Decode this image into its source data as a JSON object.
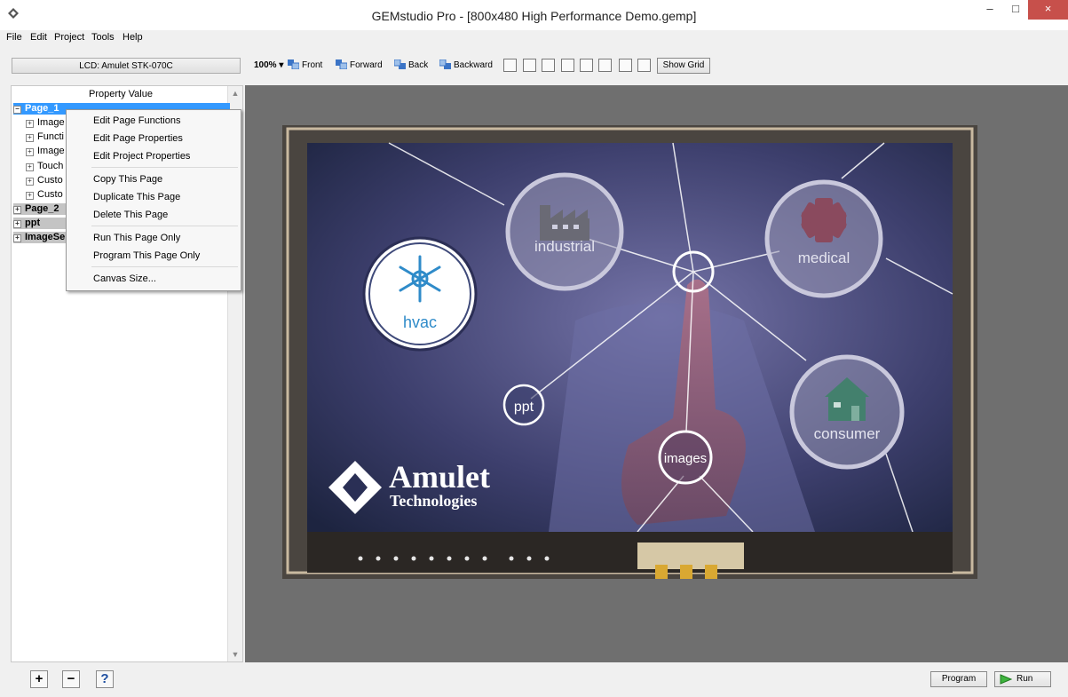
{
  "window": {
    "title": "GEMstudio Pro - [800x480 High Performance Demo.gemp]",
    "minimize": "–",
    "maximize": "□",
    "close": "×"
  },
  "menu": [
    "File",
    "Edit",
    "Project",
    "Tools",
    "Help"
  ],
  "toolbar": {
    "lcd_label": "LCD: Amulet STK-070C",
    "zoom": "100%",
    "front": "Front",
    "forward": "Forward",
    "back": "Back",
    "backward": "Backward",
    "show_grid": "Show Grid"
  },
  "panel": {
    "header": "Property  Value"
  },
  "tree": {
    "page1": "Page_1",
    "children": [
      "Image",
      "Functi",
      "Image",
      "Touch",
      "Custo",
      "Custo"
    ],
    "page2": "Page_2",
    "ppt": "ppt",
    "imagese": "ImageSe"
  },
  "context_menu": {
    "group1": [
      "Edit Page Functions",
      "Edit Page Properties",
      "Edit Project Properties"
    ],
    "group2": [
      "Copy This Page",
      "Duplicate This Page",
      "Delete This Page"
    ],
    "group3": [
      "Run This Page Only",
      "Program This Page Only"
    ],
    "group4": [
      "Canvas Size..."
    ]
  },
  "canvas": {
    "nodes": {
      "industrial": "industrial",
      "medical": "medical",
      "hvac": "hvac",
      "ppt": "ppt",
      "images": "images",
      "consumer": "consumer"
    },
    "brand": {
      "name": "Amulet",
      "sub": "Technologies"
    }
  },
  "bottom": {
    "add": "+",
    "remove": "−",
    "help": "?",
    "program": "Program",
    "run": "Run"
  },
  "colors": {
    "selection": "#3399ff",
    "close": "#c7504b",
    "workspace": "#6f6f6f"
  }
}
